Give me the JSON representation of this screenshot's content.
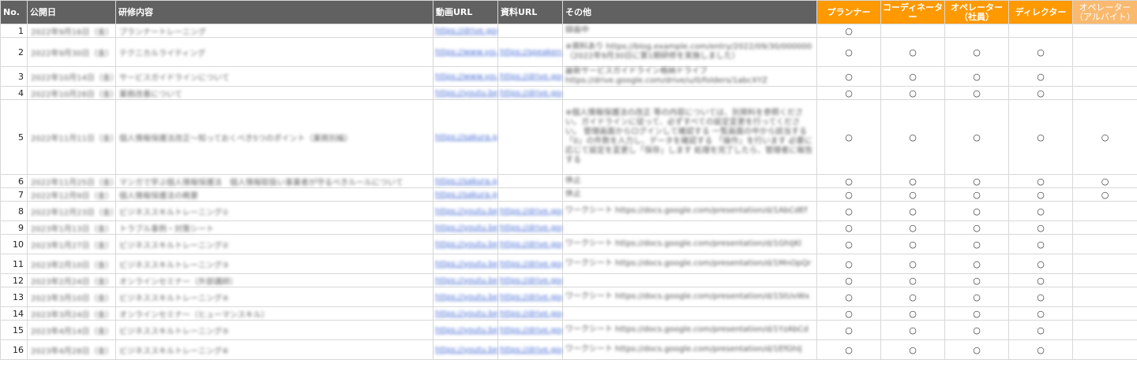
{
  "headers": {
    "no": "No.",
    "date": "公開日",
    "content": "研修内容",
    "video": "動画URL",
    "material": "資料URL",
    "other": "その他",
    "planner": "プランナー",
    "coordinator": "コーディネーター",
    "operator_staff_1": "オペレーター",
    "operator_staff_2": "（社員）",
    "director": "ディレクター",
    "operator_part_1": "オペレーター",
    "operator_part_2": "（アルバイト）"
  },
  "colors": {
    "header_gray": "#616161",
    "header_orange": "#ff9900",
    "header_orange_light": "#f9b96e"
  },
  "rows": [
    {
      "no": "1",
      "date": "2022年9月16日（金）",
      "content": "プランナートレーニング",
      "video": "https://drive.goo",
      "material": "",
      "other": "録画中",
      "marks": [
        "○",
        "",
        "",
        "",
        ""
      ]
    },
    {
      "no": "2",
      "date": "2022年9月30日（金）",
      "content": "テクニカルライティング",
      "video": "https://www.you",
      "material": "https://speakerdeck",
      "other": "※資料あり https://blog.example.com/entry/2022/09/30/000000 （2022年9月30日に第1期研修を実施しました）",
      "marks": [
        "○",
        "○",
        "○",
        "○",
        ""
      ]
    },
    {
      "no": "3",
      "date": "2022年10月14日（金）",
      "content": "サービスガイドラインについて",
      "video": "https://www.you",
      "material": "https://drive.goo",
      "other": "最新サービスガイドライン格納ドライブ https://drive.google.com/drive/u/0/folders/1abcXYZ",
      "marks": [
        "○",
        "○",
        "○",
        "○",
        ""
      ]
    },
    {
      "no": "4",
      "date": "2022年10月28日（金）",
      "content": "業務改善について",
      "video": "https://youtu.be/",
      "material": "https://drive.goo",
      "other": "",
      "marks": [
        "○",
        "○",
        "○",
        "○",
        ""
      ]
    },
    {
      "no": "5",
      "date": "2022年11月11日（金）",
      "content": "個人情報保護法改正～知っておくべき5つのポイント（業務別編）",
      "video": "https://sakura.goo",
      "material": "",
      "other": "※個人情報保護法の改正 等の内容については、別資料を参照ください。ガイドラインに従って、必ずすべての設定変更を行ってください。 管理画面からログインして確認する 一覧画面の中から該当する「0」の件数を入力し、データを確認する 「操作」を行います 必要に応じて設定を変更し「保存」します 処理を完了したら、管理者に報告する",
      "marks": [
        "○",
        "○",
        "○",
        "○",
        "○"
      ]
    },
    {
      "no": "6",
      "date": "2022年11月25日（金）",
      "content": "マンガで学ぶ個人情報保護法　個人情報取扱い事業者が守るべきルールについて",
      "video": "https://sakura.goo",
      "material": "",
      "other": "休止",
      "marks": [
        "○",
        "○",
        "○",
        "○",
        "○"
      ]
    },
    {
      "no": "7",
      "date": "2022年12月9日（金）",
      "content": "個人情報保護法の概要",
      "video": "https://sakura.goo",
      "material": "",
      "other": "休止",
      "marks": [
        "○",
        "○",
        "○",
        "○",
        "○"
      ]
    },
    {
      "no": "8",
      "date": "2022年12月23日（金）",
      "content": "ビジネススキルトレーニング①",
      "video": "https://youtu.be/",
      "material": "https://drive.goo",
      "other": "ワークシート https://docs.google.com/presentation/d/1AbCdEf",
      "marks": [
        "○",
        "○",
        "○",
        "○",
        ""
      ]
    },
    {
      "no": "9",
      "date": "2023年1月13日（金）",
      "content": "トラブル事例・対策シート",
      "video": "https://youtu.be/",
      "material": "https://drive.goo",
      "other": "",
      "marks": [
        "○",
        "○",
        "○",
        "○",
        ""
      ]
    },
    {
      "no": "10",
      "date": "2023年1月27日（金）",
      "content": "ビジネススキルトレーニング②",
      "video": "https://youtu.be/",
      "material": "https://drive.goo",
      "other": "ワークシート https://docs.google.com/presentation/d/1GhIjKl",
      "marks": [
        "○",
        "○",
        "○",
        "○",
        ""
      ]
    },
    {
      "no": "11",
      "date": "2023年2月10日（金）",
      "content": "ビジネススキルトレーニング③",
      "video": "https://youtu.be/",
      "material": "https://drive.goo",
      "other": "ワークシート https://docs.google.com/presentation/d/1MnOpQr",
      "marks": [
        "○",
        "○",
        "○",
        "○",
        ""
      ]
    },
    {
      "no": "12",
      "date": "2023年2月24日（金）",
      "content": "オンラインセミナー（外部講師）",
      "video": "https://youtu.be/",
      "material": "https://drive.goo",
      "other": "",
      "marks": [
        "○",
        "○",
        "○",
        "○",
        ""
      ]
    },
    {
      "no": "13",
      "date": "2023年3月10日（金）",
      "content": "ビジネススキルトレーニング④",
      "video": "https://youtu.be/",
      "material": "https://drive.goo",
      "other": "ワークシート https://docs.google.com/presentation/d/1StUvWx",
      "marks": [
        "○",
        "○",
        "○",
        "○",
        ""
      ]
    },
    {
      "no": "14",
      "date": "2023年3月24日（金）",
      "content": "オンラインセミナー（ヒューマンスキル）",
      "video": "https://youtu.be/",
      "material": "https://drive.goo",
      "other": "",
      "marks": [
        "○",
        "○",
        "○",
        "○",
        ""
      ]
    },
    {
      "no": "15",
      "date": "2023年4月14日（金）",
      "content": "ビジネススキルトレーニング⑤",
      "video": "https://youtu.be/",
      "material": "https://drive.goo",
      "other": "ワークシート https://docs.google.com/presentation/d/1YzAbCd",
      "marks": [
        "○",
        "○",
        "○",
        "○",
        ""
      ]
    },
    {
      "no": "16",
      "date": "2023年4月28日（金）",
      "content": "ビジネススキルトレーニング⑥",
      "video": "https://youtu.be/",
      "material": "https://drive.goo",
      "other": "ワークシート https://docs.google.com/presentation/d/1EfGhIj",
      "marks": [
        "○",
        "○",
        "○",
        "○",
        ""
      ]
    }
  ]
}
